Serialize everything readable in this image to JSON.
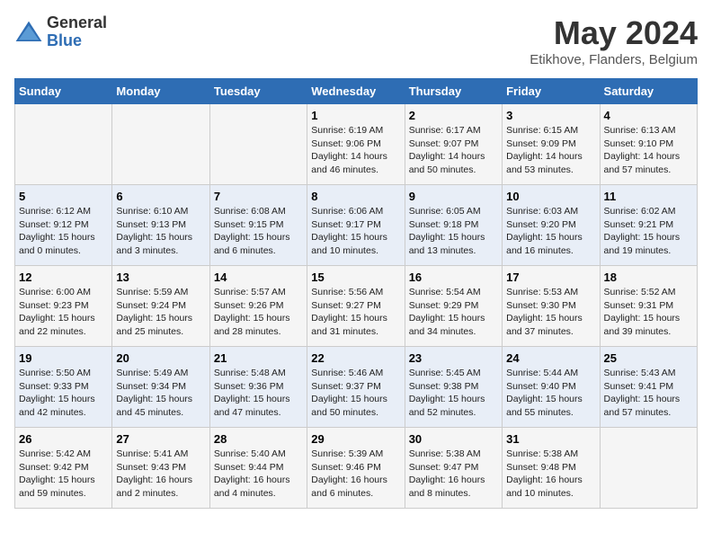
{
  "logo": {
    "general": "General",
    "blue": "Blue"
  },
  "title": "May 2024",
  "subtitle": "Etikhove, Flanders, Belgium",
  "days_of_week": [
    "Sunday",
    "Monday",
    "Tuesday",
    "Wednesday",
    "Thursday",
    "Friday",
    "Saturday"
  ],
  "weeks": [
    [
      {
        "day": "",
        "text": ""
      },
      {
        "day": "",
        "text": ""
      },
      {
        "day": "",
        "text": ""
      },
      {
        "day": "1",
        "text": "Sunrise: 6:19 AM\nSunset: 9:06 PM\nDaylight: 14 hours\nand 46 minutes."
      },
      {
        "day": "2",
        "text": "Sunrise: 6:17 AM\nSunset: 9:07 PM\nDaylight: 14 hours\nand 50 minutes."
      },
      {
        "day": "3",
        "text": "Sunrise: 6:15 AM\nSunset: 9:09 PM\nDaylight: 14 hours\nand 53 minutes."
      },
      {
        "day": "4",
        "text": "Sunrise: 6:13 AM\nSunset: 9:10 PM\nDaylight: 14 hours\nand 57 minutes."
      }
    ],
    [
      {
        "day": "5",
        "text": "Sunrise: 6:12 AM\nSunset: 9:12 PM\nDaylight: 15 hours\nand 0 minutes."
      },
      {
        "day": "6",
        "text": "Sunrise: 6:10 AM\nSunset: 9:13 PM\nDaylight: 15 hours\nand 3 minutes."
      },
      {
        "day": "7",
        "text": "Sunrise: 6:08 AM\nSunset: 9:15 PM\nDaylight: 15 hours\nand 6 minutes."
      },
      {
        "day": "8",
        "text": "Sunrise: 6:06 AM\nSunset: 9:17 PM\nDaylight: 15 hours\nand 10 minutes."
      },
      {
        "day": "9",
        "text": "Sunrise: 6:05 AM\nSunset: 9:18 PM\nDaylight: 15 hours\nand 13 minutes."
      },
      {
        "day": "10",
        "text": "Sunrise: 6:03 AM\nSunset: 9:20 PM\nDaylight: 15 hours\nand 16 minutes."
      },
      {
        "day": "11",
        "text": "Sunrise: 6:02 AM\nSunset: 9:21 PM\nDaylight: 15 hours\nand 19 minutes."
      }
    ],
    [
      {
        "day": "12",
        "text": "Sunrise: 6:00 AM\nSunset: 9:23 PM\nDaylight: 15 hours\nand 22 minutes."
      },
      {
        "day": "13",
        "text": "Sunrise: 5:59 AM\nSunset: 9:24 PM\nDaylight: 15 hours\nand 25 minutes."
      },
      {
        "day": "14",
        "text": "Sunrise: 5:57 AM\nSunset: 9:26 PM\nDaylight: 15 hours\nand 28 minutes."
      },
      {
        "day": "15",
        "text": "Sunrise: 5:56 AM\nSunset: 9:27 PM\nDaylight: 15 hours\nand 31 minutes."
      },
      {
        "day": "16",
        "text": "Sunrise: 5:54 AM\nSunset: 9:29 PM\nDaylight: 15 hours\nand 34 minutes."
      },
      {
        "day": "17",
        "text": "Sunrise: 5:53 AM\nSunset: 9:30 PM\nDaylight: 15 hours\nand 37 minutes."
      },
      {
        "day": "18",
        "text": "Sunrise: 5:52 AM\nSunset: 9:31 PM\nDaylight: 15 hours\nand 39 minutes."
      }
    ],
    [
      {
        "day": "19",
        "text": "Sunrise: 5:50 AM\nSunset: 9:33 PM\nDaylight: 15 hours\nand 42 minutes."
      },
      {
        "day": "20",
        "text": "Sunrise: 5:49 AM\nSunset: 9:34 PM\nDaylight: 15 hours\nand 45 minutes."
      },
      {
        "day": "21",
        "text": "Sunrise: 5:48 AM\nSunset: 9:36 PM\nDaylight: 15 hours\nand 47 minutes."
      },
      {
        "day": "22",
        "text": "Sunrise: 5:46 AM\nSunset: 9:37 PM\nDaylight: 15 hours\nand 50 minutes."
      },
      {
        "day": "23",
        "text": "Sunrise: 5:45 AM\nSunset: 9:38 PM\nDaylight: 15 hours\nand 52 minutes."
      },
      {
        "day": "24",
        "text": "Sunrise: 5:44 AM\nSunset: 9:40 PM\nDaylight: 15 hours\nand 55 minutes."
      },
      {
        "day": "25",
        "text": "Sunrise: 5:43 AM\nSunset: 9:41 PM\nDaylight: 15 hours\nand 57 minutes."
      }
    ],
    [
      {
        "day": "26",
        "text": "Sunrise: 5:42 AM\nSunset: 9:42 PM\nDaylight: 15 hours\nand 59 minutes."
      },
      {
        "day": "27",
        "text": "Sunrise: 5:41 AM\nSunset: 9:43 PM\nDaylight: 16 hours\nand 2 minutes."
      },
      {
        "day": "28",
        "text": "Sunrise: 5:40 AM\nSunset: 9:44 PM\nDaylight: 16 hours\nand 4 minutes."
      },
      {
        "day": "29",
        "text": "Sunrise: 5:39 AM\nSunset: 9:46 PM\nDaylight: 16 hours\nand 6 minutes."
      },
      {
        "day": "30",
        "text": "Sunrise: 5:38 AM\nSunset: 9:47 PM\nDaylight: 16 hours\nand 8 minutes."
      },
      {
        "day": "31",
        "text": "Sunrise: 5:38 AM\nSunset: 9:48 PM\nDaylight: 16 hours\nand 10 minutes."
      },
      {
        "day": "",
        "text": ""
      }
    ]
  ]
}
